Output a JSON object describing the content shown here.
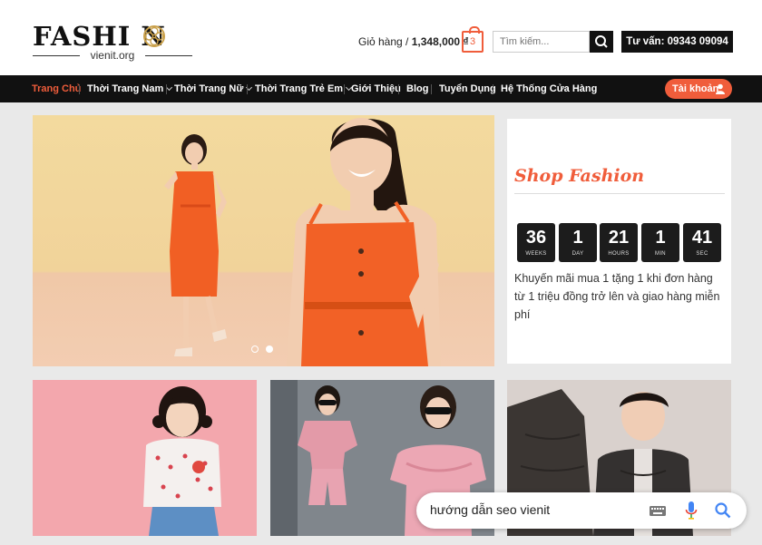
{
  "brand": {
    "logo_main": "FASHI N",
    "logo_sub": "vienit.org"
  },
  "header": {
    "cart_label": "Giỏ hàng / ",
    "cart_total": "1,348,000 ₫",
    "cart_count": "3",
    "search_placeholder": "Tìm kiếm...",
    "hotline": "Tư vấn: 09343 09094"
  },
  "nav": {
    "items": [
      {
        "label": "Trang Chủ",
        "active": true
      },
      {
        "label": "Thời Trang Nam",
        "dropdown": true
      },
      {
        "label": "Thời Trang Nữ",
        "dropdown": true
      },
      {
        "label": "Thời Trang Trẻ Em",
        "dropdown": true
      },
      {
        "label": "Giới Thiệu"
      },
      {
        "label": "Blog"
      },
      {
        "label": "Tuyển Dụng"
      },
      {
        "label": "Hệ Thống Cửa Hàng"
      }
    ],
    "account_label": "Tài khoản"
  },
  "slider": {
    "slide_count": 2,
    "active_slide": 2
  },
  "promo": {
    "title": "Shop Fashion",
    "countdown": [
      {
        "value": "36",
        "unit": "WEEKS"
      },
      {
        "value": "1",
        "unit": "DAY"
      },
      {
        "value": "21",
        "unit": "HOURS"
      },
      {
        "value": "1",
        "unit": "MIN"
      },
      {
        "value": "41",
        "unit": "SEC"
      }
    ],
    "text": "Khuyến mãi mua 1 tặng 1 khi đơn hàng từ 1 triệu đồng trở lên và giao hàng miễn phí"
  },
  "google_search": {
    "query": "hướng dẫn seo vienit"
  },
  "colors": {
    "accent": "#f05d3b",
    "dark": "#111111",
    "background": "#e9e9e9"
  }
}
